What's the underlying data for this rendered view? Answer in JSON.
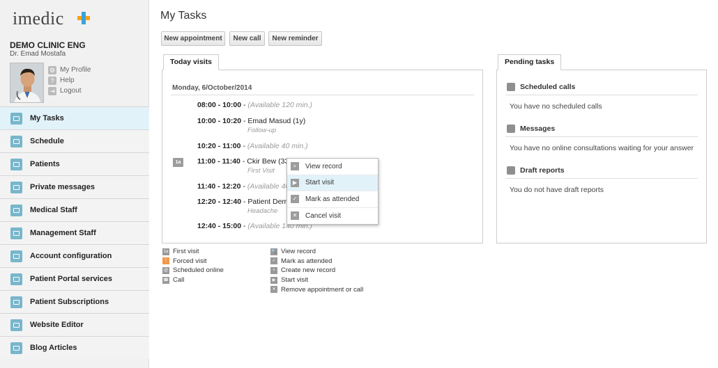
{
  "brand": {
    "name": "imedic"
  },
  "user": {
    "clinic": "DEMO CLINIC ENG",
    "doctor": "Dr. Emad Mostafa",
    "links": [
      "My Profile",
      "Help",
      "Logout"
    ]
  },
  "nav": [
    {
      "label": "My Tasks",
      "icon": "tasks-icon"
    },
    {
      "label": "Schedule",
      "icon": "calendar-icon"
    },
    {
      "label": "Patients",
      "icon": "patients-icon"
    },
    {
      "label": "Private messages",
      "icon": "message-icon"
    },
    {
      "label": "Medical Staff",
      "icon": "briefcase-icon"
    },
    {
      "label": "Management Staff",
      "icon": "headset-icon"
    },
    {
      "label": "Account configuration",
      "icon": "house-icon"
    },
    {
      "label": "Patient Portal services",
      "icon": "cart-icon"
    },
    {
      "label": "Patient Subscriptions",
      "icon": "subscription-icon"
    },
    {
      "label": "Website Editor",
      "icon": "monitor-icon"
    },
    {
      "label": "Blog Articles",
      "icon": "article-icon"
    }
  ],
  "main": {
    "title": "My Tasks",
    "buttons": [
      "New appointment",
      "New call",
      "New reminder"
    ]
  },
  "today": {
    "tab": "Today visits",
    "date": "Monday, 6/October/2014",
    "slots": [
      {
        "time": "08:00 - 10:00",
        "sep": " - ",
        "name": "",
        "avail": "(Available 120 min.)",
        "note": ""
      },
      {
        "time": "10:00 - 10:20",
        "sep": " - ",
        "name": "Emad Masud (1y)",
        "avail": "",
        "note": "Follow-up"
      },
      {
        "time": "10:20 - 11:00",
        "sep": " - ",
        "name": "",
        "avail": "(Available 40 min.)",
        "note": ""
      },
      {
        "time": "11:00 - 11:40",
        "sep": " - ",
        "name": "Ckir Bew (33",
        "avail": "",
        "note": "First Visit"
      },
      {
        "time": "11:40 - 12:20",
        "sep": " - ",
        "name": "",
        "avail": "(Available 40",
        "note": ""
      },
      {
        "time": "12:20 - 12:40",
        "sep": " - ",
        "name": "Patient Demo",
        "avail": "",
        "note": "Headache"
      },
      {
        "time": "12:40 - 15:00",
        "sep": " - ",
        "name": "",
        "avail": "(Available 140 min.)",
        "note": ""
      }
    ],
    "first_visit_badge": "1a"
  },
  "context_menu": [
    "View record",
    "Start visit",
    "Mark as attended",
    "Cancel visit"
  ],
  "legend_left": [
    {
      "label": "First visit",
      "glyph": "1a"
    },
    {
      "label": "Forced visit",
      "glyph": "!"
    },
    {
      "label": "Scheduled online",
      "glyph": "@"
    },
    {
      "label": "Call",
      "glyph": "☎"
    }
  ],
  "legend_right": [
    {
      "label": "View record",
      "glyph": "🔍"
    },
    {
      "label": "Mark as attended",
      "glyph": "✓"
    },
    {
      "label": "Create new record",
      "glyph": "+"
    },
    {
      "label": "Start visit",
      "glyph": "▶"
    },
    {
      "label": "Remove appointment or call",
      "glyph": "✕"
    }
  ],
  "pending": {
    "tab": "Pending tasks",
    "sections": [
      {
        "title": "Scheduled calls",
        "text": "You have no scheduled calls"
      },
      {
        "title": "Messages",
        "text": "You have no online consultations waiting for your answer"
      },
      {
        "title": "Draft reports",
        "text": "You do not have draft reports"
      }
    ]
  },
  "colors": {
    "accent": "#e2f2f9",
    "nav_icon": "#78b6cb",
    "logo_orange": "#f7a21b",
    "logo_blue": "#3aa3d8"
  }
}
